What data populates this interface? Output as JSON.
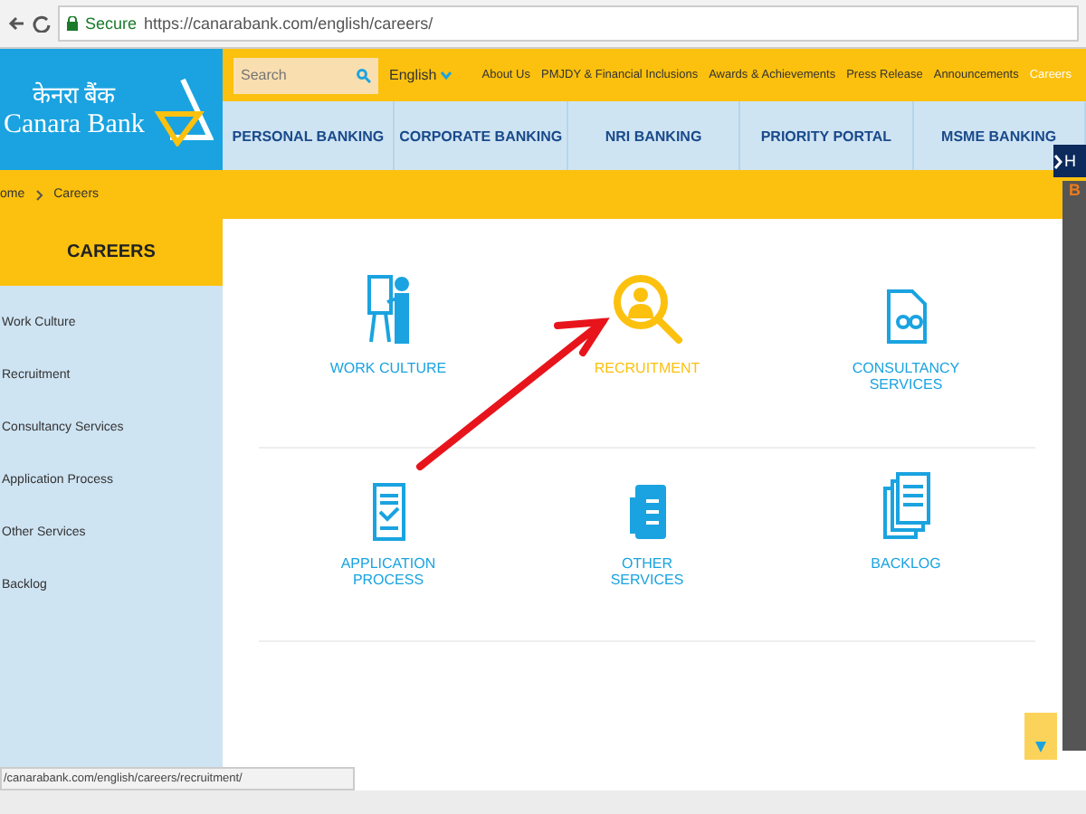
{
  "browser": {
    "security": "Secure",
    "url": "https://canarabank.com/english/careers/"
  },
  "logo": {
    "hindi": "केनरा बैंक",
    "name": "Canara Bank"
  },
  "search": {
    "placeholder": "Search"
  },
  "language": "English",
  "top_links": [
    {
      "label": "About Us",
      "selected": false
    },
    {
      "label": "PMJDY & Financial Inclusions",
      "selected": false
    },
    {
      "label": "Awards & Achievements",
      "selected": false
    },
    {
      "label": "Press Release",
      "selected": false
    },
    {
      "label": "Announcements",
      "selected": false
    },
    {
      "label": "Careers",
      "selected": true
    }
  ],
  "nav": [
    "PERSONAL BANKING",
    "CORPORATE BANKING",
    "NRI BANKING",
    "PRIORITY PORTAL",
    "MSME BANKING"
  ],
  "breadcrumb": [
    "ome",
    "Careers"
  ],
  "sidebar": {
    "title": "CAREERS",
    "items": [
      "Work Culture",
      "Recruitment",
      "Consultancy Services",
      "Application Process",
      "Other Services",
      "Backlog"
    ]
  },
  "cards": [
    {
      "kind": "presenter",
      "label": "WORK CULTURE",
      "selected": false
    },
    {
      "kind": "recruit",
      "label": "RECRUITMENT",
      "selected": true
    },
    {
      "kind": "consult",
      "label": "CONSULTANCY SERVICES",
      "selected": false
    },
    {
      "kind": "form",
      "label": "APPLICATION PROCESS",
      "selected": false
    },
    {
      "kind": "services",
      "label": "OTHER SERVICES",
      "selected": false
    },
    {
      "kind": "backlog",
      "label": "BACKLOG",
      "selected": false
    }
  ],
  "side_panel": {
    "toggle": "H",
    "badge": "B"
  },
  "status_url": "/canarabank.com/english/careers/recruitment/"
}
